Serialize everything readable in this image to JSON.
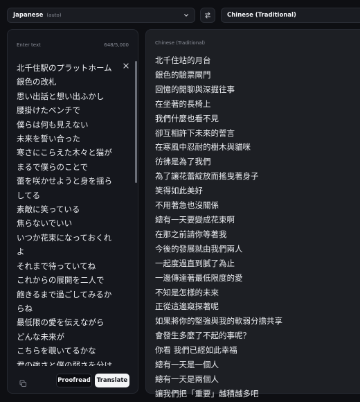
{
  "top_bar": {
    "source_language": "Japanese",
    "source_detect": "(auto)",
    "target_language": "Chinese (Traditional)"
  },
  "source_panel": {
    "label": "Enter text",
    "char_count": "648/5,000",
    "lines": [
      "北千住駅のプラットホーム",
      "銀色の改札",
      "思い出話と想い出ふかし",
      "腰掛けたベンチで",
      "僕らは何も見えない",
      "未来を誓い合った",
      "寒さにこらえた木々と猫が",
      "まるで僕らのことで",
      "蕾を咲かせようと身を揺ら",
      "してる",
      "素敵に笑っている",
      "焦らないでいい",
      "いつか花束になっておくれ",
      "よ",
      "それまで待っていてね",
      "これからの展開を二人で",
      "飽きるまで過ごしてみるか",
      "らね",
      "最低限の愛を伝えながら",
      "どんな未来が",
      "こちらを覗いてるかな",
      "君の強さと僕の弱さを分け"
    ],
    "proofread_label": "Proofread",
    "translate_label": "Translate"
  },
  "target_panel": {
    "label": "Chinese (Traditional)",
    "lines": [
      "北千住站的月台",
      "銀色的驗票閘門",
      "回憶的閒聊與深掘往事",
      "在坐著的長椅上",
      "我們什麼也看不見",
      "卻互相許下未來的誓言",
      "在寒風中忍耐的樹木與貓咪",
      "彷彿是為了我們",
      "為了讓花蕾綻放而搖曳著身子",
      "笑得如此美好",
      "不用著急也沒關係",
      "總有一天要變成花束啊",
      "在那之前請你等著我",
      "今後的發展就由我們兩人",
      "一起度過直到膩了為止",
      "一邊傳達著最低限度的愛",
      "不知是怎樣的未來",
      "正從這邊窺探著呢",
      "如果將你的堅強與我的軟弱分擔共享",
      "會發生多麼了不起的事呢？",
      "你看 我們已經如此幸福",
      "總有一天是一個人",
      "總有一天是兩個人",
      "讓我們把「重要」越積越多吧"
    ]
  },
  "icons": {
    "chevron": "chevron-down-icon",
    "swap": "swap-icon",
    "clear": "close-icon",
    "copy": "copy-icon"
  },
  "colors": {
    "background": "#0e0f13",
    "panel_source": "#15171d",
    "panel_target": "#1d1f24",
    "translate_button": "#f4f5f7"
  }
}
